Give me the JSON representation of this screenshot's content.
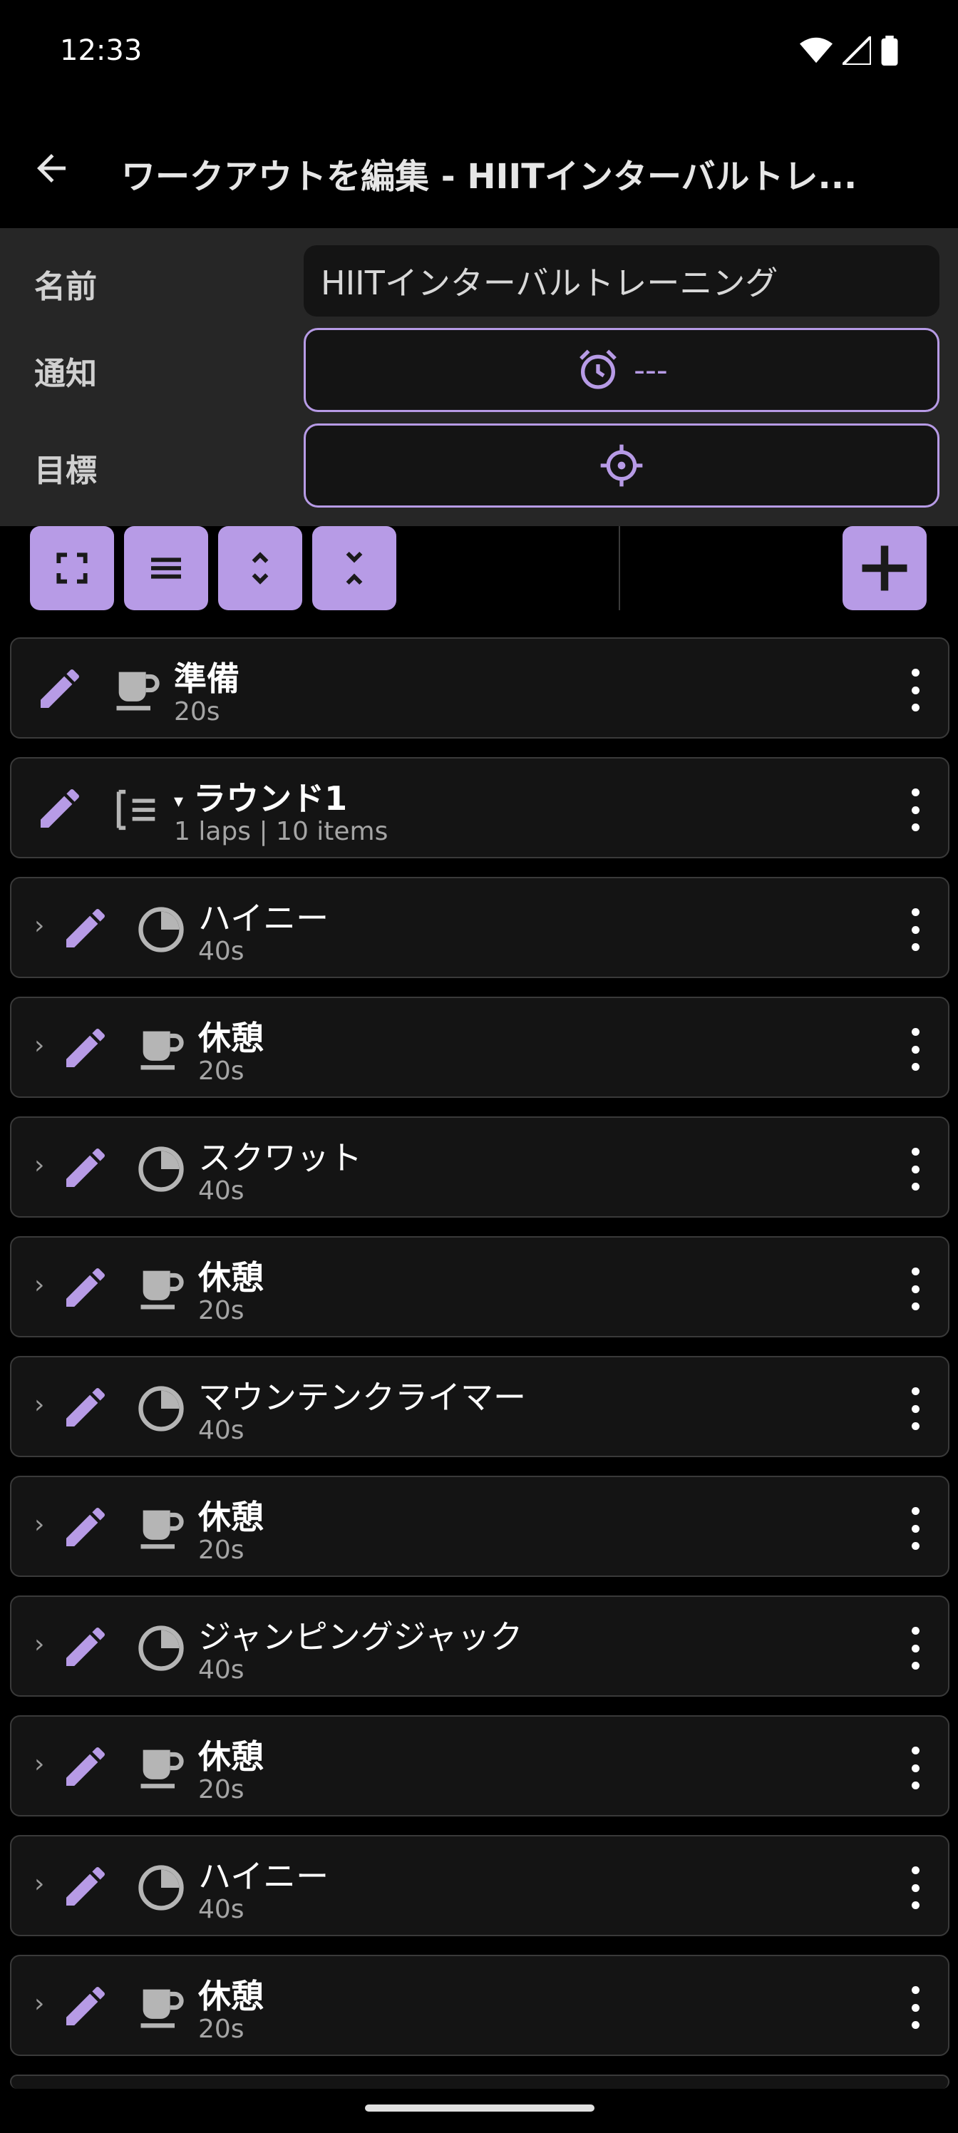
{
  "status_bar": {
    "time": "12:33",
    "icons": [
      "wifi-icon",
      "signal-icon",
      "battery-icon"
    ]
  },
  "app_bar": {
    "title": "ワークアウトを編集 - HIITインターバルトレ..."
  },
  "settings": {
    "name_label": "名前",
    "name_value": "HIITインターバルトレーニング",
    "notification_label": "通知",
    "notification_value": "---",
    "target_label": "目標"
  },
  "toolbar": {
    "buttons": [
      "fullscreen-icon",
      "list-icon",
      "expand-icon",
      "collapse-icon"
    ],
    "add": "add-icon"
  },
  "colors": {
    "accent": "#b79be6",
    "background": "#000000",
    "card": "#141414",
    "panel": "#262626"
  },
  "items": [
    {
      "title": "準備",
      "subtitle": "20s",
      "type": "rest",
      "nested": false,
      "bold": true
    },
    {
      "title": "ラウンド1",
      "subtitle": "1 laps | 10 items",
      "type": "group",
      "nested": false,
      "bold": true,
      "expand_glyph": "▾"
    },
    {
      "title": "ハイニー",
      "subtitle": "40s",
      "type": "timer",
      "nested": true,
      "bold": false
    },
    {
      "title": "休憩",
      "subtitle": "20s",
      "type": "rest",
      "nested": true,
      "bold": true
    },
    {
      "title": "スクワット",
      "subtitle": "40s",
      "type": "timer",
      "nested": true,
      "bold": false
    },
    {
      "title": "休憩",
      "subtitle": "20s",
      "type": "rest",
      "nested": true,
      "bold": true
    },
    {
      "title": "マウンテンクライマー",
      "subtitle": "40s",
      "type": "timer",
      "nested": true,
      "bold": false
    },
    {
      "title": "休憩",
      "subtitle": "20s",
      "type": "rest",
      "nested": true,
      "bold": true
    },
    {
      "title": "ジャンピングジャック",
      "subtitle": "40s",
      "type": "timer",
      "nested": true,
      "bold": false
    },
    {
      "title": "休憩",
      "subtitle": "20s",
      "type": "rest",
      "nested": true,
      "bold": true
    },
    {
      "title": "ハイニー",
      "subtitle": "40s",
      "type": "timer",
      "nested": true,
      "bold": false
    },
    {
      "title": "休憩",
      "subtitle": "20s",
      "type": "rest",
      "nested": true,
      "bold": true
    }
  ],
  "chevron_glyph": "›"
}
